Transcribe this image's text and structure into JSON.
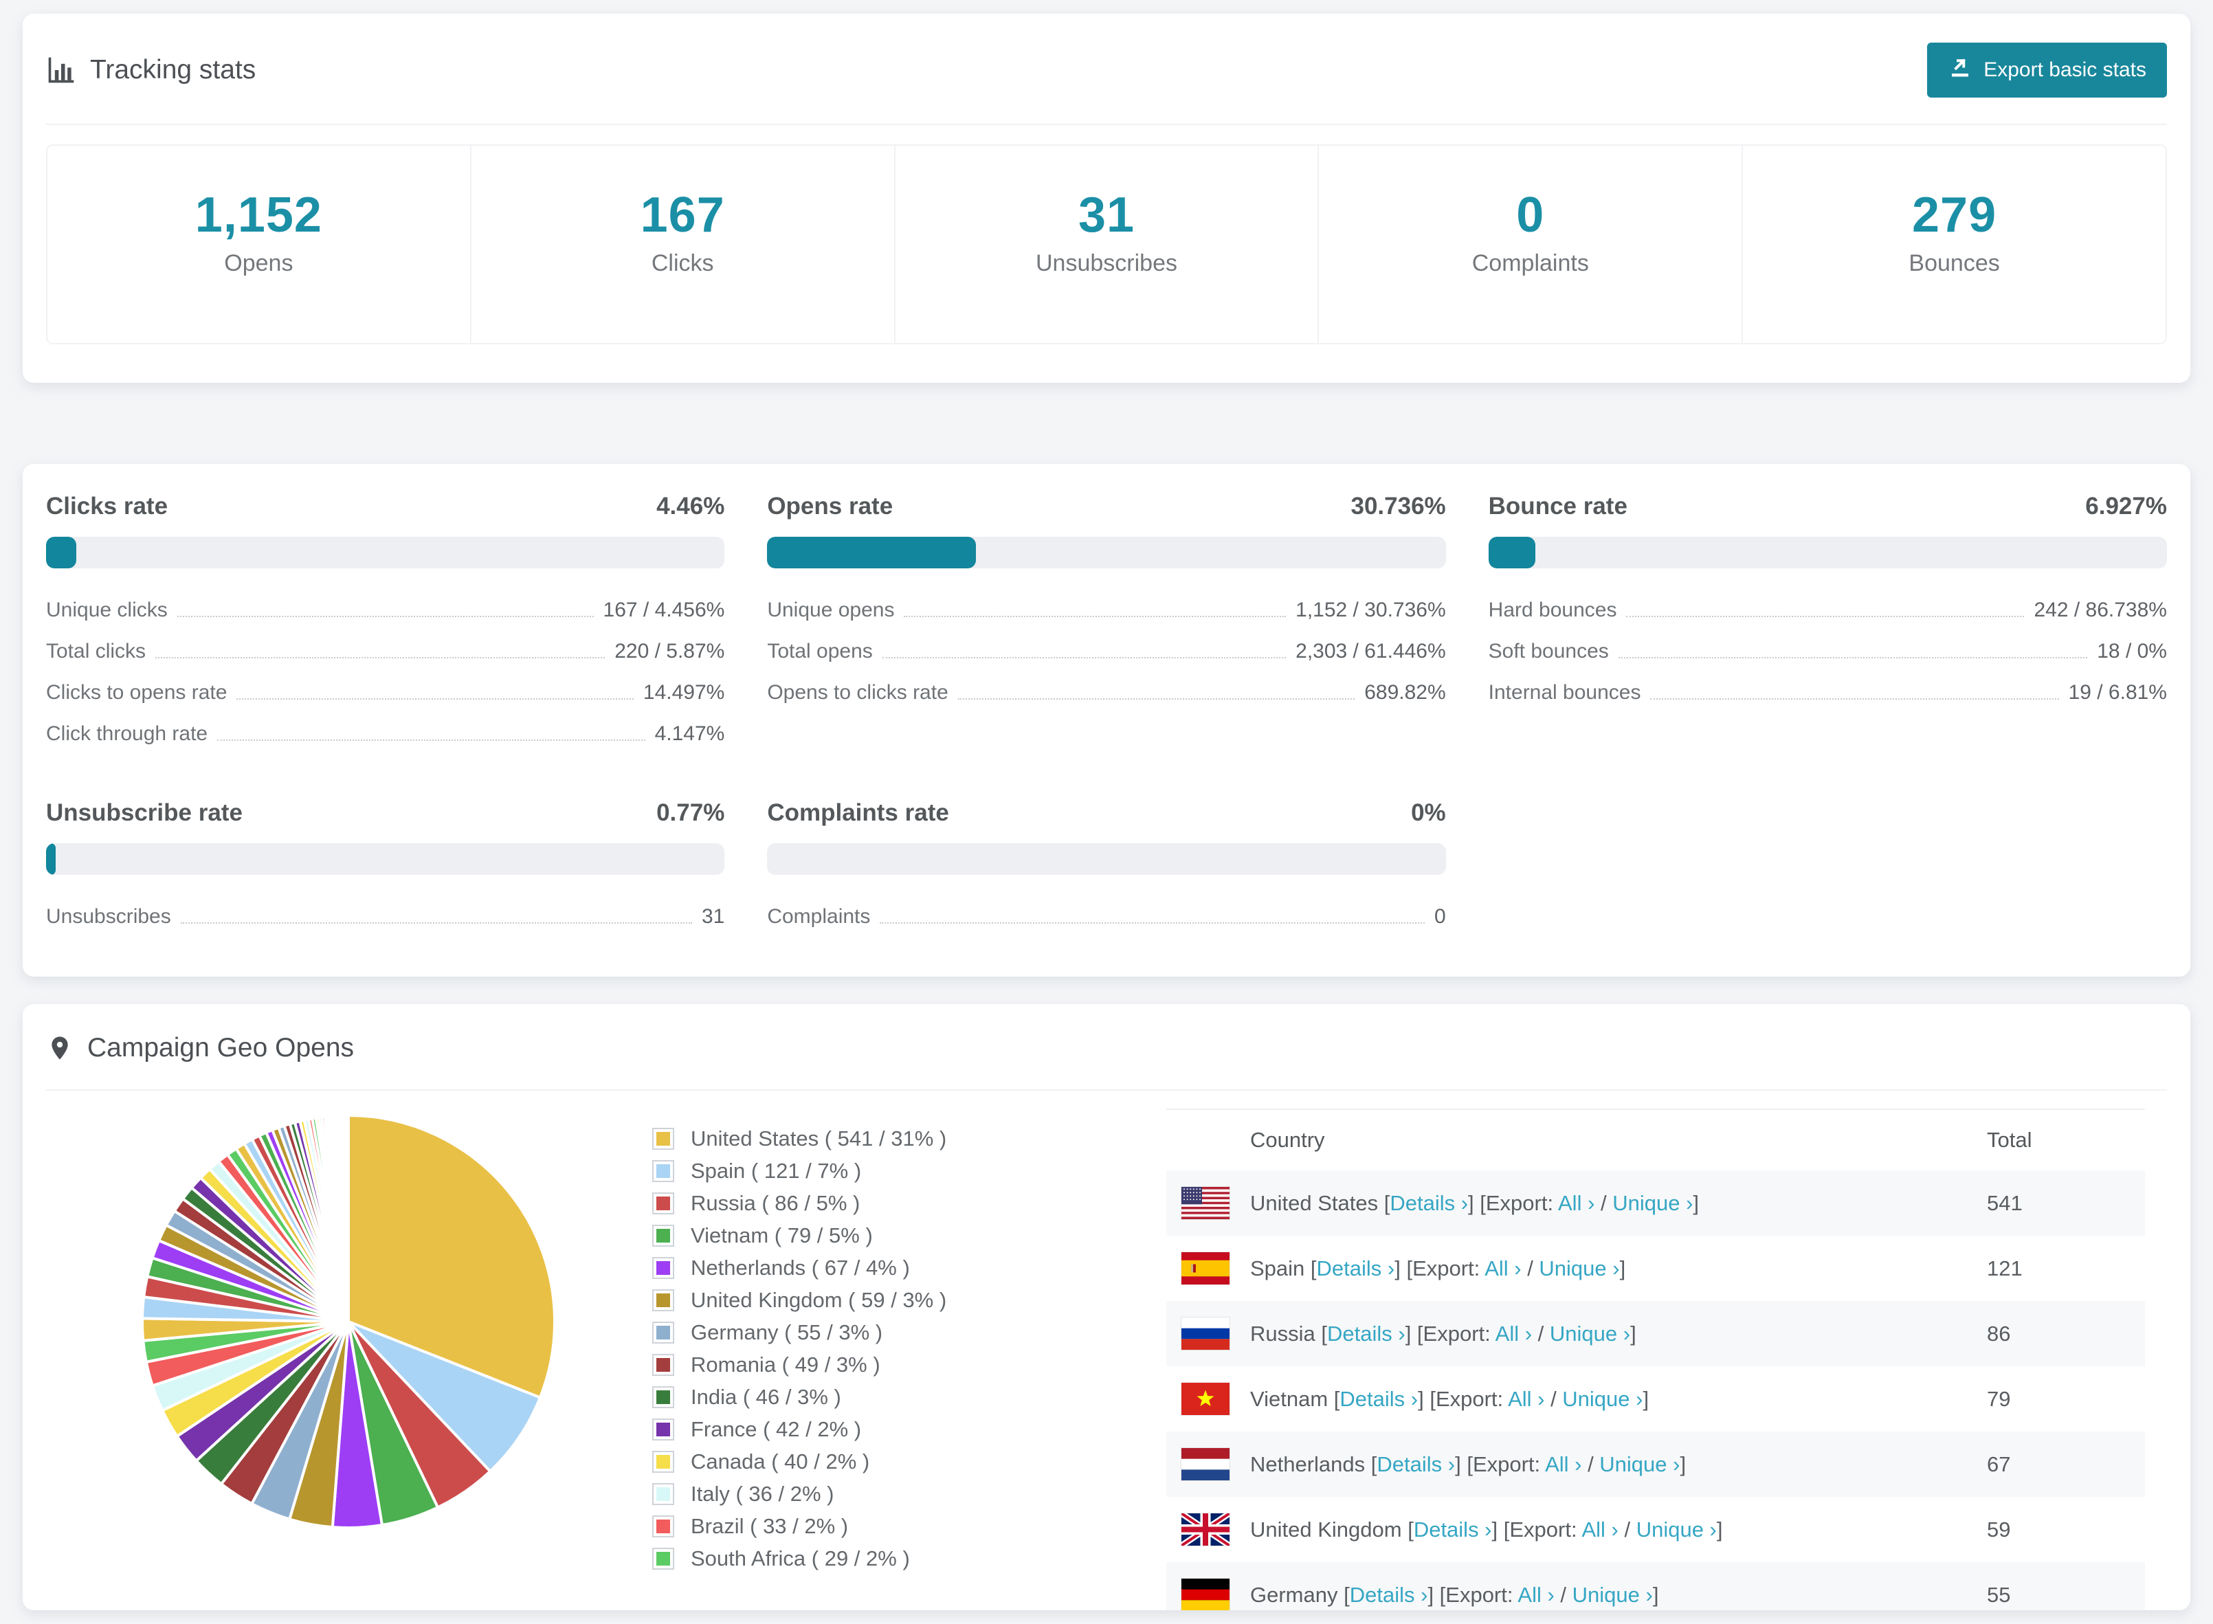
{
  "colors": {
    "accent_teal": "#1b8fa6",
    "button_teal": "#19879b",
    "bar_fill_teal": "#12869c",
    "link_teal": "#35a6c4",
    "bar_track": "#edeff2",
    "row_stripe": "#f7f8f9"
  },
  "tracking": {
    "title": "Tracking stats",
    "title_icon": "bar-chart-icon",
    "export_button": "Export basic stats",
    "summary_stats": [
      {
        "value": "1,152",
        "label": "Opens"
      },
      {
        "value": "167",
        "label": "Clicks"
      },
      {
        "value": "31",
        "label": "Unsubscribes"
      },
      {
        "value": "0",
        "label": "Complaints"
      },
      {
        "value": "279",
        "label": "Bounces"
      }
    ]
  },
  "rates": [
    {
      "title": "Clicks rate",
      "value": "4.46%",
      "bar_percent": 4.46,
      "rows": [
        {
          "label": "Unique clicks",
          "value": "167 / 4.456%"
        },
        {
          "label": "Total clicks",
          "value": "220 / 5.87%"
        },
        {
          "label": "Clicks to opens rate",
          "value": "14.497%"
        },
        {
          "label": "Click through rate",
          "value": "4.147%"
        }
      ]
    },
    {
      "title": "Opens rate",
      "value": "30.736%",
      "bar_percent": 30.736,
      "rows": [
        {
          "label": "Unique opens",
          "value": "1,152 / 30.736%"
        },
        {
          "label": "Total opens",
          "value": "2,303 / 61.446%"
        },
        {
          "label": "Opens to clicks rate",
          "value": "689.82%"
        }
      ]
    },
    {
      "title": "Bounce rate",
      "value": "6.927%",
      "bar_percent": 6.927,
      "rows": [
        {
          "label": "Hard bounces",
          "value": "242 / 86.738%"
        },
        {
          "label": "Soft bounces",
          "value": "18 / 0%"
        },
        {
          "label": "Internal bounces",
          "value": "19 / 6.81%"
        }
      ]
    },
    {
      "title": "Unsubscribe rate",
      "value": "0.77%",
      "bar_percent": 0.77,
      "rows": [
        {
          "label": "Unsubscribes",
          "value": "31"
        }
      ]
    },
    {
      "title": "Complaints rate",
      "value": "0%",
      "bar_percent": 0,
      "rows": [
        {
          "label": "Complaints",
          "value": "0"
        }
      ]
    }
  ],
  "geo": {
    "title": "Campaign Geo Opens",
    "title_icon": "map-pin-icon",
    "table": {
      "columns": [
        "Country",
        "Total"
      ],
      "details_label": "Details ›",
      "export_prefix": "Export:",
      "all_label": "All ›",
      "unique_label": "Unique ›",
      "rows": [
        {
          "flag": "us",
          "country": "United States",
          "total": "541"
        },
        {
          "flag": "es",
          "country": "Spain",
          "total": "121"
        },
        {
          "flag": "ru",
          "country": "Russia",
          "total": "86"
        },
        {
          "flag": "vn",
          "country": "Vietnam",
          "total": "79"
        },
        {
          "flag": "nl",
          "country": "Netherlands",
          "total": "67"
        },
        {
          "flag": "gb",
          "country": "United Kingdom",
          "total": "59"
        },
        {
          "flag": "de",
          "country": "Germany",
          "total": "55"
        }
      ]
    }
  },
  "chart_data": {
    "type": "pie",
    "title": "Campaign Geo Opens",
    "legend_position": "right",
    "start_angle_deg": -90,
    "direction": "clockwise",
    "slices": [
      {
        "label": "United States",
        "value": 541,
        "pct": 31,
        "color": "#e9c046"
      },
      {
        "label": "Spain",
        "value": 121,
        "pct": 7,
        "color": "#aad4f5"
      },
      {
        "label": "Russia",
        "value": 86,
        "pct": 5,
        "color": "#cc4c4c"
      },
      {
        "label": "Vietnam",
        "value": 79,
        "pct": 5,
        "color": "#4caf50"
      },
      {
        "label": "Netherlands",
        "value": 67,
        "pct": 4,
        "color": "#9d3ef5"
      },
      {
        "label": "United Kingdom",
        "value": 59,
        "pct": 3,
        "color": "#b8962e"
      },
      {
        "label": "Germany",
        "value": 55,
        "pct": 3,
        "color": "#8fafcf"
      },
      {
        "label": "Romania",
        "value": 49,
        "pct": 3,
        "color": "#a43d3d"
      },
      {
        "label": "India",
        "value": 46,
        "pct": 3,
        "color": "#397d3c"
      },
      {
        "label": "France",
        "value": 42,
        "pct": 2,
        "color": "#7633ab"
      },
      {
        "label": "Canada",
        "value": 40,
        "pct": 2,
        "color": "#f6dd4a"
      },
      {
        "label": "Italy",
        "value": 36,
        "pct": 2,
        "color": "#d8f8f8"
      },
      {
        "label": "Brazil",
        "value": 33,
        "pct": 2,
        "color": "#f25c5c"
      },
      {
        "label": "South Africa",
        "value": 29,
        "pct": 2,
        "color": "#5bcb63"
      }
    ],
    "other_slices_unlabeled": [
      30,
      29,
      28,
      26,
      25,
      23,
      22,
      20,
      19,
      18,
      17,
      16,
      15,
      14,
      13,
      12,
      11,
      10,
      9,
      9,
      8,
      8,
      7,
      7,
      6,
      6,
      5,
      5,
      4,
      4,
      4,
      3,
      3,
      3,
      3,
      2,
      2,
      2,
      2,
      2,
      1,
      1,
      1,
      1,
      1,
      1,
      1,
      1,
      1,
      1
    ],
    "total_estimated": 1745
  }
}
